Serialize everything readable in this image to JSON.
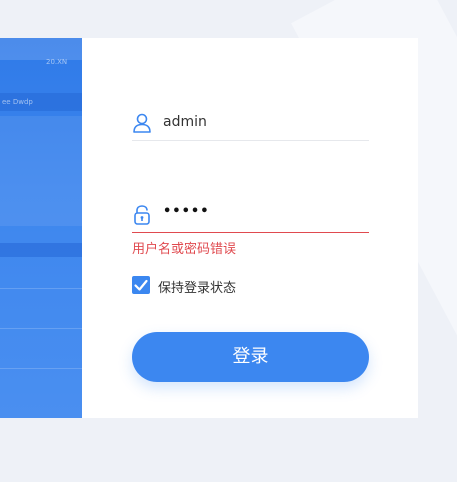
{
  "hero": {
    "caption_top": "20.XN",
    "caption_side": "ee Dwdp"
  },
  "login": {
    "username_value": "admin",
    "password_value": "•••••",
    "error_message": "用户名或密码错误",
    "remember_label": "保持登录状态",
    "remember_checked": true,
    "submit_label": "登录"
  },
  "colors": {
    "accent": "#3c87f0",
    "error": "#e04a4f",
    "background": "#eef1f7"
  }
}
